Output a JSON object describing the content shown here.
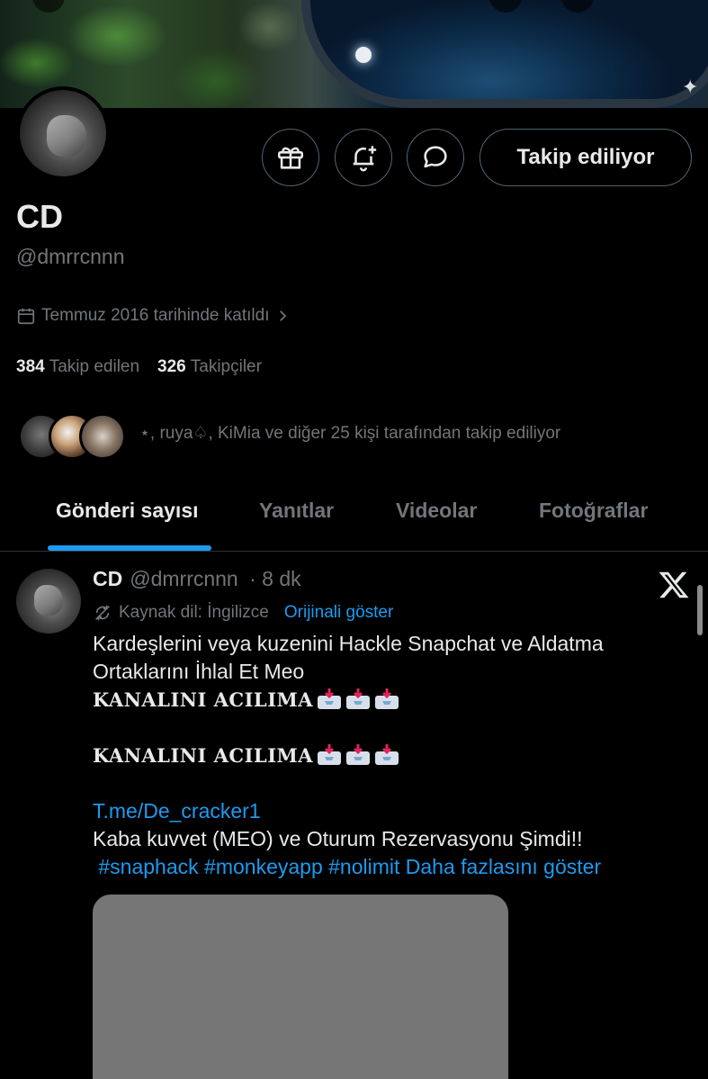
{
  "profile": {
    "name": "CD",
    "handle": "@dmrrcnnn",
    "joined": "Temmuz 2016 tarihinde katıldı",
    "following_count": "384",
    "following_label": "Takip edilen",
    "followers_count": "326",
    "followers_label": "Takipçiler",
    "followed_by_text": "⋆, ruya♤, KiMia ve diğer 25 kişi tarafından takip ediliyor",
    "follow_button_label": "Takip ediliyor"
  },
  "tabs": [
    {
      "label": "Gönderi sayısı",
      "active": true
    },
    {
      "label": "Yanıtlar",
      "active": false
    },
    {
      "label": "Videolar",
      "active": false
    },
    {
      "label": "Fotoğraflar",
      "active": false
    }
  ],
  "post": {
    "author_name": "CD",
    "author_handle": "@dmrrcnnn",
    "time": "· 8 dk",
    "source_language": "Kaynak dil: İngilizce",
    "show_original": "Orijinali göster",
    "lines": [
      "Kardeşlerini veya kuzenini Hackle Snapchat ve Aldatma",
      "Ortaklarını İhlal Et Meo",
      "KANALINI ACILIMA",
      "KANALINI ACILIMA",
      "T.me/De_cracker1",
      "Kaba kuvvet (MEO) ve Oturum Rezervasyonu Şimdi!!",
      " #snaphack #monkeyapp #nolimit Daha fazlasını göster"
    ]
  },
  "colors": {
    "accent": "#1d9bf0",
    "background": "#000000",
    "text": "#e7e9ea",
    "muted": "#71767b",
    "border": "#536471"
  }
}
